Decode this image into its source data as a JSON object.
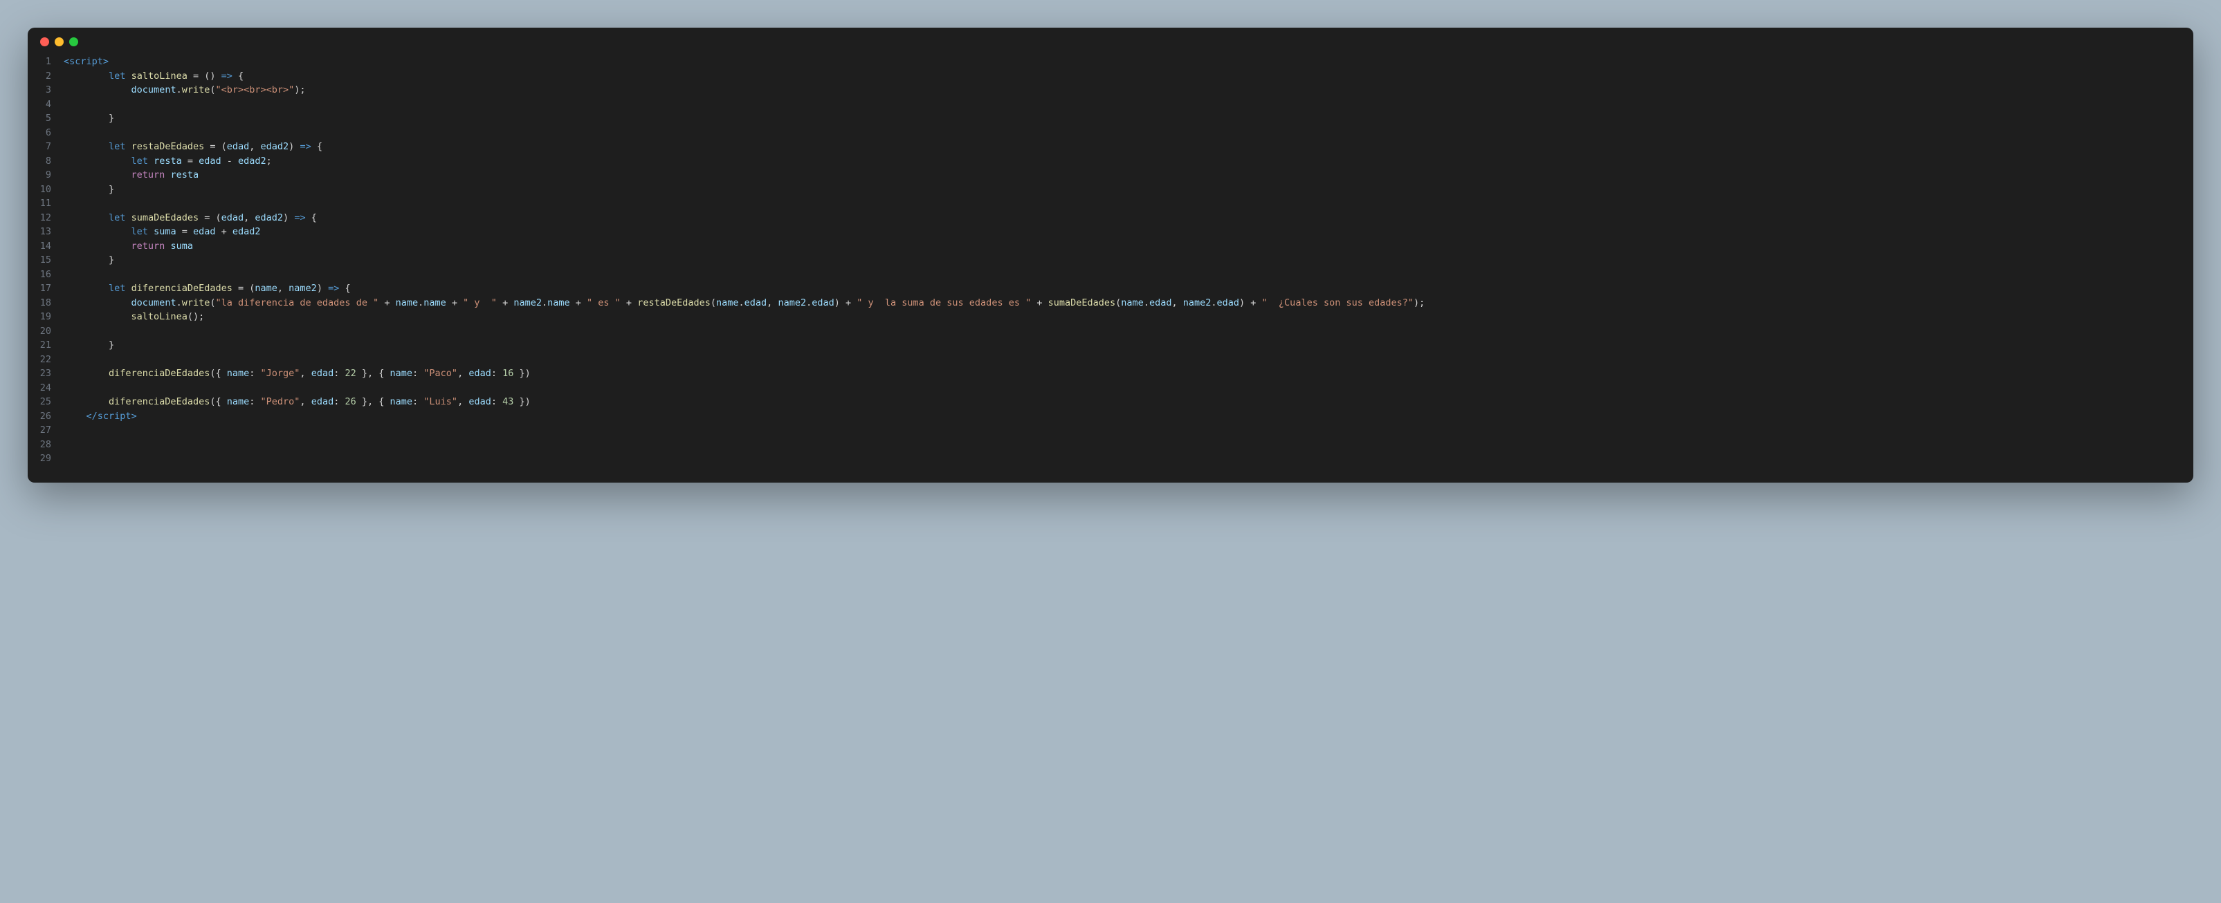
{
  "window": {
    "traffic_lights": [
      "red",
      "yellow",
      "green"
    ]
  },
  "code": {
    "line_count": 29,
    "tokens": [
      [
        {
          "t": "<",
          "c": "tag"
        },
        {
          "t": "script",
          "c": "tag"
        },
        {
          "t": ">",
          "c": "tag"
        }
      ],
      [
        {
          "t": "        ",
          "c": "punct"
        },
        {
          "t": "let",
          "c": "keyword"
        },
        {
          "t": " ",
          "c": "punct"
        },
        {
          "t": "saltoLinea",
          "c": "fn"
        },
        {
          "t": " = () ",
          "c": "punct"
        },
        {
          "t": "=>",
          "c": "keyword"
        },
        {
          "t": " {",
          "c": "punct"
        }
      ],
      [
        {
          "t": "            ",
          "c": "punct"
        },
        {
          "t": "document",
          "c": "ident"
        },
        {
          "t": ".",
          "c": "punct"
        },
        {
          "t": "write",
          "c": "fn"
        },
        {
          "t": "(",
          "c": "punct"
        },
        {
          "t": "\"<br><br><br>\"",
          "c": "str"
        },
        {
          "t": ");",
          "c": "punct"
        }
      ],
      [],
      [
        {
          "t": "        }",
          "c": "punct"
        }
      ],
      [],
      [
        {
          "t": "        ",
          "c": "punct"
        },
        {
          "t": "let",
          "c": "keyword"
        },
        {
          "t": " ",
          "c": "punct"
        },
        {
          "t": "restaDeEdades",
          "c": "fn"
        },
        {
          "t": " = (",
          "c": "punct"
        },
        {
          "t": "edad",
          "c": "ident"
        },
        {
          "t": ", ",
          "c": "punct"
        },
        {
          "t": "edad2",
          "c": "ident"
        },
        {
          "t": ") ",
          "c": "punct"
        },
        {
          "t": "=>",
          "c": "keyword"
        },
        {
          "t": " {",
          "c": "punct"
        }
      ],
      [
        {
          "t": "            ",
          "c": "punct"
        },
        {
          "t": "let",
          "c": "keyword"
        },
        {
          "t": " ",
          "c": "punct"
        },
        {
          "t": "resta",
          "c": "ident"
        },
        {
          "t": " = ",
          "c": "punct"
        },
        {
          "t": "edad",
          "c": "ident"
        },
        {
          "t": " - ",
          "c": "punct"
        },
        {
          "t": "edad2",
          "c": "ident"
        },
        {
          "t": ";",
          "c": "punct"
        }
      ],
      [
        {
          "t": "            ",
          "c": "punct"
        },
        {
          "t": "return",
          "c": "keyword2"
        },
        {
          "t": " ",
          "c": "punct"
        },
        {
          "t": "resta",
          "c": "ident"
        }
      ],
      [
        {
          "t": "        }",
          "c": "punct"
        }
      ],
      [],
      [
        {
          "t": "        ",
          "c": "punct"
        },
        {
          "t": "let",
          "c": "keyword"
        },
        {
          "t": " ",
          "c": "punct"
        },
        {
          "t": "sumaDeEdades",
          "c": "fn"
        },
        {
          "t": " = (",
          "c": "punct"
        },
        {
          "t": "edad",
          "c": "ident"
        },
        {
          "t": ", ",
          "c": "punct"
        },
        {
          "t": "edad2",
          "c": "ident"
        },
        {
          "t": ") ",
          "c": "punct"
        },
        {
          "t": "=>",
          "c": "keyword"
        },
        {
          "t": " {",
          "c": "punct"
        }
      ],
      [
        {
          "t": "            ",
          "c": "punct"
        },
        {
          "t": "let",
          "c": "keyword"
        },
        {
          "t": " ",
          "c": "punct"
        },
        {
          "t": "suma",
          "c": "ident"
        },
        {
          "t": " = ",
          "c": "punct"
        },
        {
          "t": "edad",
          "c": "ident"
        },
        {
          "t": " + ",
          "c": "punct"
        },
        {
          "t": "edad2",
          "c": "ident"
        }
      ],
      [
        {
          "t": "            ",
          "c": "punct"
        },
        {
          "t": "return",
          "c": "keyword2"
        },
        {
          "t": " ",
          "c": "punct"
        },
        {
          "t": "suma",
          "c": "ident"
        }
      ],
      [
        {
          "t": "        }",
          "c": "punct"
        }
      ],
      [],
      [
        {
          "t": "        ",
          "c": "punct"
        },
        {
          "t": "let",
          "c": "keyword"
        },
        {
          "t": " ",
          "c": "punct"
        },
        {
          "t": "diferenciaDeEdades",
          "c": "fn"
        },
        {
          "t": " = (",
          "c": "punct"
        },
        {
          "t": "name",
          "c": "ident"
        },
        {
          "t": ", ",
          "c": "punct"
        },
        {
          "t": "name2",
          "c": "ident"
        },
        {
          "t": ") ",
          "c": "punct"
        },
        {
          "t": "=>",
          "c": "keyword"
        },
        {
          "t": " {",
          "c": "punct"
        }
      ],
      [
        {
          "t": "            ",
          "c": "punct"
        },
        {
          "t": "document",
          "c": "ident"
        },
        {
          "t": ".",
          "c": "punct"
        },
        {
          "t": "write",
          "c": "fn"
        },
        {
          "t": "(",
          "c": "punct"
        },
        {
          "t": "\"la diferencia de edades de \"",
          "c": "str"
        },
        {
          "t": " + ",
          "c": "punct"
        },
        {
          "t": "name",
          "c": "ident"
        },
        {
          "t": ".",
          "c": "punct"
        },
        {
          "t": "name",
          "c": "prop"
        },
        {
          "t": " + ",
          "c": "punct"
        },
        {
          "t": "\" y  \"",
          "c": "str"
        },
        {
          "t": " + ",
          "c": "punct"
        },
        {
          "t": "name2",
          "c": "ident"
        },
        {
          "t": ".",
          "c": "punct"
        },
        {
          "t": "name",
          "c": "prop"
        },
        {
          "t": " + ",
          "c": "punct"
        },
        {
          "t": "\" es \"",
          "c": "str"
        },
        {
          "t": " + ",
          "c": "punct"
        },
        {
          "t": "restaDeEdades",
          "c": "fn"
        },
        {
          "t": "(",
          "c": "punct"
        },
        {
          "t": "name",
          "c": "ident"
        },
        {
          "t": ".",
          "c": "punct"
        },
        {
          "t": "edad",
          "c": "prop"
        },
        {
          "t": ", ",
          "c": "punct"
        },
        {
          "t": "name2",
          "c": "ident"
        },
        {
          "t": ".",
          "c": "punct"
        },
        {
          "t": "edad",
          "c": "prop"
        },
        {
          "t": ") + ",
          "c": "punct"
        },
        {
          "t": "\" y  la suma de sus edades es \"",
          "c": "str"
        },
        {
          "t": " + ",
          "c": "punct"
        },
        {
          "t": "sumaDeEdades",
          "c": "fn"
        },
        {
          "t": "(",
          "c": "punct"
        },
        {
          "t": "name",
          "c": "ident"
        },
        {
          "t": ".",
          "c": "punct"
        },
        {
          "t": "edad",
          "c": "prop"
        },
        {
          "t": ", ",
          "c": "punct"
        },
        {
          "t": "name2",
          "c": "ident"
        },
        {
          "t": ".",
          "c": "punct"
        },
        {
          "t": "edad",
          "c": "prop"
        },
        {
          "t": ") + ",
          "c": "punct"
        },
        {
          "t": "\"  ¿Cuales son sus edades?\"",
          "c": "str"
        },
        {
          "t": ");",
          "c": "punct"
        }
      ],
      [
        {
          "t": "            ",
          "c": "punct"
        },
        {
          "t": "saltoLinea",
          "c": "fn"
        },
        {
          "t": "();",
          "c": "punct"
        }
      ],
      [],
      [
        {
          "t": "        }",
          "c": "punct"
        }
      ],
      [],
      [
        {
          "t": "        ",
          "c": "punct"
        },
        {
          "t": "diferenciaDeEdades",
          "c": "fn"
        },
        {
          "t": "({ ",
          "c": "punct"
        },
        {
          "t": "name",
          "c": "prop"
        },
        {
          "t": ": ",
          "c": "punct"
        },
        {
          "t": "\"Jorge\"",
          "c": "str"
        },
        {
          "t": ", ",
          "c": "punct"
        },
        {
          "t": "edad",
          "c": "prop"
        },
        {
          "t": ": ",
          "c": "punct"
        },
        {
          "t": "22",
          "c": "num"
        },
        {
          "t": " }, { ",
          "c": "punct"
        },
        {
          "t": "name",
          "c": "prop"
        },
        {
          "t": ": ",
          "c": "punct"
        },
        {
          "t": "\"Paco\"",
          "c": "str"
        },
        {
          "t": ", ",
          "c": "punct"
        },
        {
          "t": "edad",
          "c": "prop"
        },
        {
          "t": ": ",
          "c": "punct"
        },
        {
          "t": "16",
          "c": "num"
        },
        {
          "t": " })",
          "c": "punct"
        }
      ],
      [],
      [
        {
          "t": "        ",
          "c": "punct"
        },
        {
          "t": "diferenciaDeEdades",
          "c": "fn"
        },
        {
          "t": "({ ",
          "c": "punct"
        },
        {
          "t": "name",
          "c": "prop"
        },
        {
          "t": ": ",
          "c": "punct"
        },
        {
          "t": "\"Pedro\"",
          "c": "str"
        },
        {
          "t": ", ",
          "c": "punct"
        },
        {
          "t": "edad",
          "c": "prop"
        },
        {
          "t": ": ",
          "c": "punct"
        },
        {
          "t": "26",
          "c": "num"
        },
        {
          "t": " }, { ",
          "c": "punct"
        },
        {
          "t": "name",
          "c": "prop"
        },
        {
          "t": ": ",
          "c": "punct"
        },
        {
          "t": "\"Luis\"",
          "c": "str"
        },
        {
          "t": ", ",
          "c": "punct"
        },
        {
          "t": "edad",
          "c": "prop"
        },
        {
          "t": ": ",
          "c": "punct"
        },
        {
          "t": "43",
          "c": "num"
        },
        {
          "t": " })",
          "c": "punct"
        }
      ],
      [
        {
          "t": "    ",
          "c": "punct"
        },
        {
          "t": "</",
          "c": "tag"
        },
        {
          "t": "script",
          "c": "tag"
        },
        {
          "t": ">",
          "c": "tag"
        }
      ],
      [],
      [],
      []
    ]
  }
}
